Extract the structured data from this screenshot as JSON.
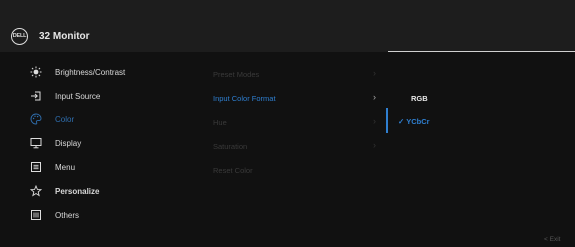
{
  "header": {
    "logo_text": "DELL",
    "title": "32 Monitor"
  },
  "menu": [
    {
      "label": "Brightness/Contrast",
      "icon": "brightness-icon"
    },
    {
      "label": "Input Source",
      "icon": "input-source-icon"
    },
    {
      "label": "Color",
      "icon": "color-palette-icon",
      "active": true
    },
    {
      "label": "Display",
      "icon": "display-icon"
    },
    {
      "label": "Menu",
      "icon": "menu-icon"
    },
    {
      "label": "Personalize",
      "icon": "star-icon"
    },
    {
      "label": "Others",
      "icon": "others-icon"
    }
  ],
  "submenu": [
    {
      "label": "Preset Modes"
    },
    {
      "label": "Input Color Format",
      "active": true
    },
    {
      "label": "Hue"
    },
    {
      "label": "Saturation"
    },
    {
      "label": "Reset Color"
    }
  ],
  "options": {
    "rgb": "RGB",
    "ycbcr": "YCbCr",
    "selected_mark": "✓"
  },
  "footer": {
    "exit_label": "Exit",
    "exit_arrow": "<"
  },
  "colors": {
    "accent": "#2f7fd0",
    "background": "#111111",
    "header_background": "#1d1d1d"
  }
}
